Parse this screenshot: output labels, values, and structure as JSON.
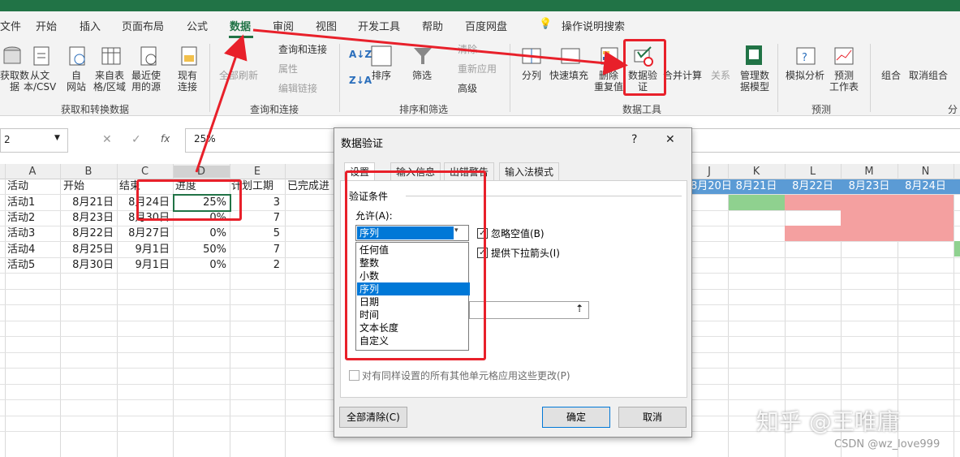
{
  "ribbon_tabs": [
    "文件",
    "开始",
    "插入",
    "页面布局",
    "公式",
    "数据",
    "审阅",
    "视图",
    "开发工具",
    "帮助",
    "百度网盘",
    "操作说明搜索"
  ],
  "ribbon": {
    "get_data": [
      "获取数",
      "据",
      "从文",
      "本/CSV",
      "自",
      "网站",
      "来自表",
      "格/区域",
      "最近使",
      "用的源",
      "现有",
      "连接"
    ],
    "group_get": "获取和转换数据",
    "refresh": [
      "全部刷新"
    ],
    "queries": [
      "查询和连接",
      "属性",
      "编辑链接"
    ],
    "group_queries": "查询和连接",
    "sort_az": "排序",
    "filter": "筛选",
    "clear": "清除",
    "reapply": "重新应用",
    "advanced": "高级",
    "group_sort": "排序和筛选",
    "split": "分列",
    "flash_fill": "快速填充",
    "remove_dup": [
      "删除",
      "重复值"
    ],
    "validation": [
      "数据验",
      "证"
    ],
    "consolidate": "合并计算",
    "relations": "关系",
    "manage_model": [
      "管理数",
      "据模型"
    ],
    "group_tools": "数据工具",
    "whatif": "模拟分析",
    "forecast": [
      "预测",
      "工作表"
    ],
    "group_forecast": "预测",
    "group_btn": "组合",
    "ungroup": "取消组合",
    "group_outline": "分"
  },
  "formula_bar": {
    "name_box": "2",
    "formula": "25%",
    "fx": "fx"
  },
  "columns": [
    "A",
    "B",
    "C",
    "D",
    "E",
    "J",
    "K",
    "L",
    "M",
    "N"
  ],
  "header_row": [
    "活动",
    "开始",
    "结束",
    "进度",
    "计划工期",
    "已完成进"
  ],
  "date_headers": [
    "8月20日",
    "8月21日",
    "8月22日",
    "8月23日",
    "8月24日"
  ],
  "rows": [
    [
      "活动1",
      "8月21日",
      "8月24日",
      "25%",
      "3"
    ],
    [
      "活动2",
      "8月23日",
      "8月30日",
      "0%",
      "7"
    ],
    [
      "活动3",
      "8月22日",
      "8月27日",
      "0%",
      "5"
    ],
    [
      "活动4",
      "8月25日",
      "9月1日",
      "50%",
      "7"
    ],
    [
      "活动5",
      "8月30日",
      "9月1日",
      "0%",
      "2"
    ]
  ],
  "dialog": {
    "title": "数据验证",
    "help": "?",
    "close": "✕",
    "tabs": [
      "设置",
      "输入信息",
      "出错警告",
      "输入法模式"
    ],
    "section": "验证条件",
    "allow_label": "允许(A):",
    "allow_value": "序列",
    "ignore_blank": "忽略空值(B)",
    "dropdown_arrow": "提供下拉箭头(I)",
    "options": [
      "任何值",
      "整数",
      "小数",
      "序列",
      "日期",
      "时间",
      "文本长度",
      "自定义"
    ],
    "apply_all": "对有同样设置的所有其他单元格应用这些更改(P)",
    "clear_all": "全部清除(C)",
    "ok": "确定",
    "cancel": "取消"
  },
  "watermark": "知乎 @王唯庸",
  "watermark2": "CSDN @wz_love999",
  "colors": {
    "excel_green": "#217346",
    "annot_red": "#e8202a",
    "gantt_green": "#8fd18f",
    "gantt_red": "#f4a0a0",
    "select_blue": "#0078d7",
    "date_header": "#5b9bd5"
  }
}
